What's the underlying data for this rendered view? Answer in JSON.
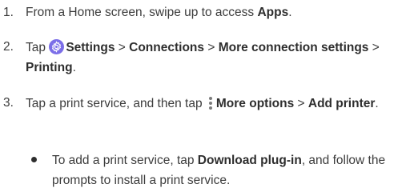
{
  "steps": [
    {
      "number": "1.",
      "text_a": "From a Home screen, swipe up to access ",
      "bold_a": "Apps",
      "text_b": "."
    },
    {
      "number": "2.",
      "text_a": "Tap ",
      "icon": "settings-gear-icon",
      "bold_a": "Settings",
      "sep_1": " > ",
      "bold_b": "Connections",
      "sep_2": " > ",
      "bold_c": "More connection settings",
      "sep_3": " > ",
      "bold_d": "Printing",
      "text_b": "."
    },
    {
      "number": "3.",
      "text_a": "Tap a print service, and then tap ",
      "icon": "more-options-icon",
      "bold_a": "More options",
      "sep_1": " > ",
      "bold_b": "Add printer",
      "text_b": "."
    }
  ],
  "bullet": {
    "text_a": "To add a print service, tap ",
    "bold_a": "Download plug-in",
    "text_b": ", and follow the prompts to install a print service."
  },
  "colors": {
    "text": "#3c3c3c",
    "bold": "#2e2e2e",
    "settings_icon_bg": "#7b6ee8"
  }
}
